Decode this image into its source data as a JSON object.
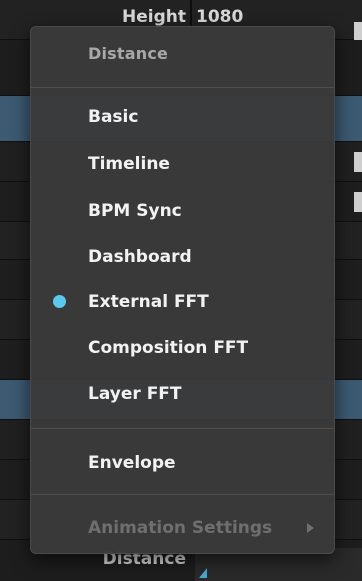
{
  "background": {
    "top_row": {
      "label": "Height",
      "value": "1080"
    },
    "bottom_row": {
      "label": "Distance"
    }
  },
  "menu": {
    "header": "Distance",
    "items": [
      {
        "label": "Basic",
        "checked": false
      },
      {
        "label": "Timeline",
        "checked": false
      },
      {
        "label": "BPM Sync",
        "checked": false
      },
      {
        "label": "Dashboard",
        "checked": false
      },
      {
        "label": "External FFT",
        "checked": true
      },
      {
        "label": "Composition FFT",
        "checked": false
      },
      {
        "label": "Layer FFT",
        "checked": false
      }
    ],
    "envelope": {
      "label": "Envelope"
    },
    "animation_settings": {
      "label": "Animation Settings",
      "enabled": false
    }
  },
  "colors": {
    "menu_bg": "#3a3a3a",
    "check_dot": "#5cc8ef",
    "selected_row": "#3c5a72",
    "disabled_text": "#6f6f6f"
  }
}
